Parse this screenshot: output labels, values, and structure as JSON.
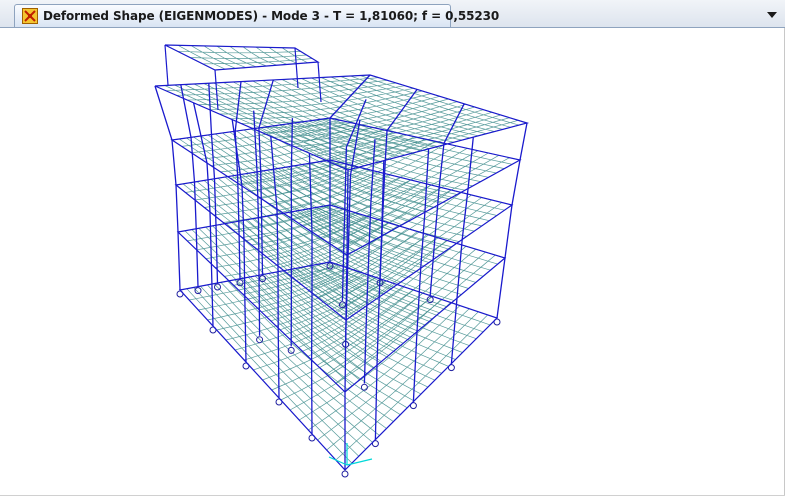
{
  "window": {
    "tab_title": "Deformed Shape (EIGENMODES) - Mode 3 - T = 1,81060;  f = 0,55230",
    "tab_icon": "deformed-shape-icon",
    "dropdown_icon": "chevron-down-icon"
  },
  "viewport": {
    "content": "3d-structural-model-deformed",
    "colors": {
      "frame": "#1a1acd",
      "slab_mesh": "#3a8a8a",
      "support": "#2020a0",
      "axis_x": "#00d8d8",
      "axis_y": "#00d8d8",
      "axis_z": "#00d8d8"
    }
  }
}
